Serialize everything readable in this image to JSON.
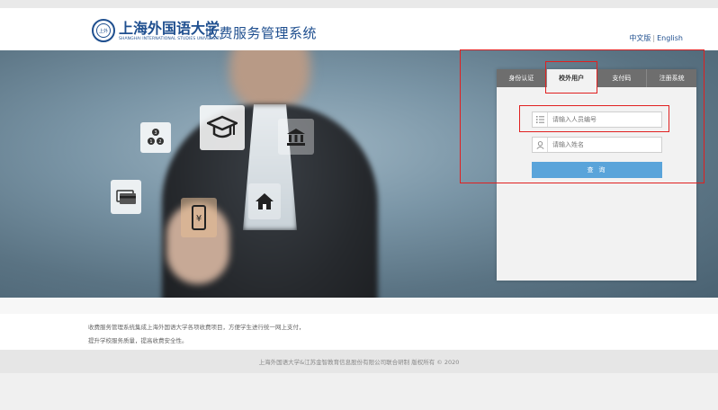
{
  "header": {
    "university_name": "上海外国语大学",
    "university_en": "SHANGHAI INTERNATIONAL STUDIES UNIVERSITY",
    "seal_text": "上外",
    "system_title": "收费服务管理系统",
    "lang_zh": "中文版",
    "lang_sep": "|",
    "lang_en": "English"
  },
  "tabs": [
    {
      "label": "身份认证",
      "active": false
    },
    {
      "label": "校外用户",
      "active": true
    },
    {
      "label": "支付码",
      "active": false
    },
    {
      "label": "注册系统",
      "active": false
    }
  ],
  "form": {
    "id_placeholder": "请输入人员编号",
    "name_placeholder": "请输入姓名",
    "query_label": "查 询"
  },
  "floating_icons": [
    "lottery-icon",
    "graduation-cap-icon",
    "bank-icon",
    "credit-card-icon",
    "mobile-payment-icon",
    "home-icon"
  ],
  "description": {
    "line1": "收费服务管理系统集成上海外国语大学各项收费项目，方便学生进行统一网上支付，",
    "line2": "提升学校服务质量，提高收费安全性。"
  },
  "footer": {
    "copyright": "上海外国语大学&江苏金智教育信息股份有限公司联合研制 版权所有 © 2020"
  },
  "colors": {
    "brand": "#1f4f8f",
    "button": "#5aa4da",
    "tab_bar": "#6e6e6e",
    "highlight_box": "#e02020"
  }
}
